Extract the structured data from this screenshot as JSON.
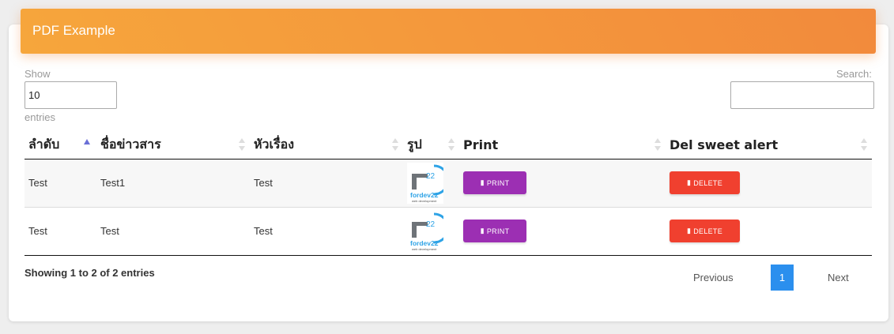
{
  "header": {
    "title": "PDF Example"
  },
  "length": {
    "show_label": "Show",
    "value": "10",
    "entries_label": "entries"
  },
  "search": {
    "label": "Search:",
    "value": ""
  },
  "table": {
    "columns": [
      "ลำดับ",
      "ชื่อข่าวสาร",
      "หัวเรื่อง",
      "รูป",
      "Print",
      "Del sweet alert"
    ],
    "rows": [
      {
        "no": "Test",
        "name": "Test1",
        "subject": "Test",
        "image": "fordev22-logo",
        "print": "PRINT",
        "delete": "DELETE"
      },
      {
        "no": "Test",
        "name": "Test",
        "subject": "Test",
        "image": "fordev22-logo",
        "print": "PRINT",
        "delete": "DELETE"
      }
    ]
  },
  "logo": {
    "number": "22",
    "brand": "fordev22",
    "tagline": "web development"
  },
  "footer": {
    "info": "Showing 1 to 2 of 2 entries"
  },
  "pagination": {
    "previous": "Previous",
    "current": "1",
    "next": "Next"
  },
  "colors": {
    "header": "#f6a63c",
    "print": "#9c2fb3",
    "delete": "#f0402f",
    "page_active": "#2b8fee"
  },
  "icons": {
    "print": "pdf-file-icon",
    "delete": "trash-icon"
  }
}
